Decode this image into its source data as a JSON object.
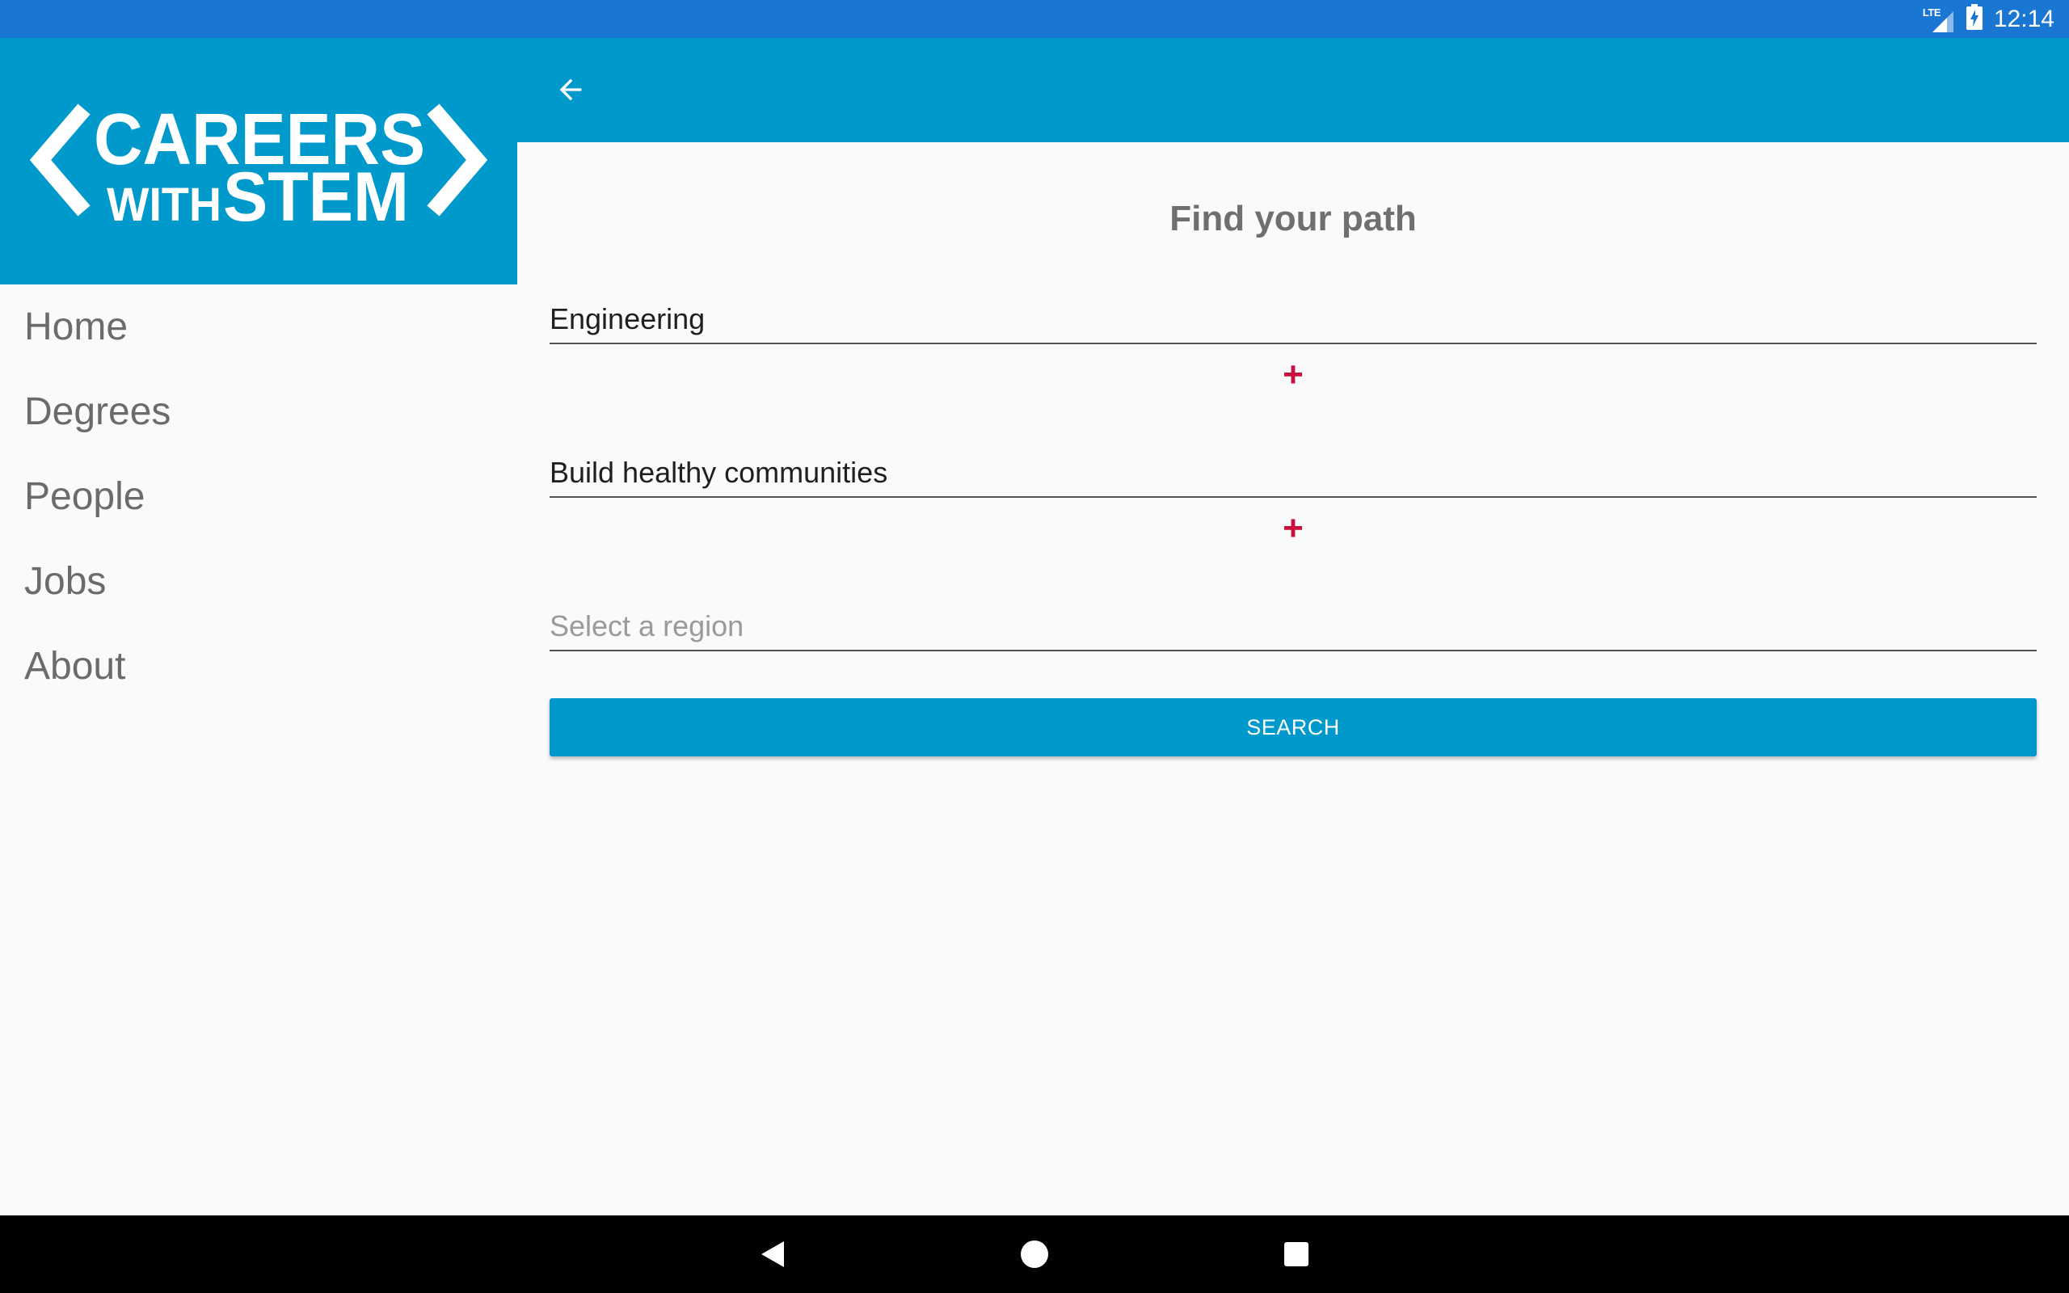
{
  "status_bar": {
    "network": "LTE",
    "time": "12:14",
    "icons": [
      "signal-icon",
      "battery-icon"
    ]
  },
  "drawer": {
    "logo": {
      "line1": "CAREERS",
      "line2_small": "WITH",
      "line2_big": "STEM"
    },
    "items": [
      {
        "label": "Home"
      },
      {
        "label": "Degrees"
      },
      {
        "label": "People"
      },
      {
        "label": "Jobs"
      },
      {
        "label": "About"
      }
    ]
  },
  "app_bar": {
    "back_icon": "arrow-back-icon"
  },
  "main": {
    "title": "Find your path",
    "field1_value": "Engineering",
    "plus_symbol": "+",
    "field2_value": "Build healthy communities",
    "region_placeholder": "Select a region",
    "search_label": "SEARCH"
  },
  "colors": {
    "status_bar": "#1976d2",
    "primary": "#0099cc",
    "accent_plus": "#c8103e",
    "background": "#fafafa",
    "nav_bar": "#000000"
  }
}
